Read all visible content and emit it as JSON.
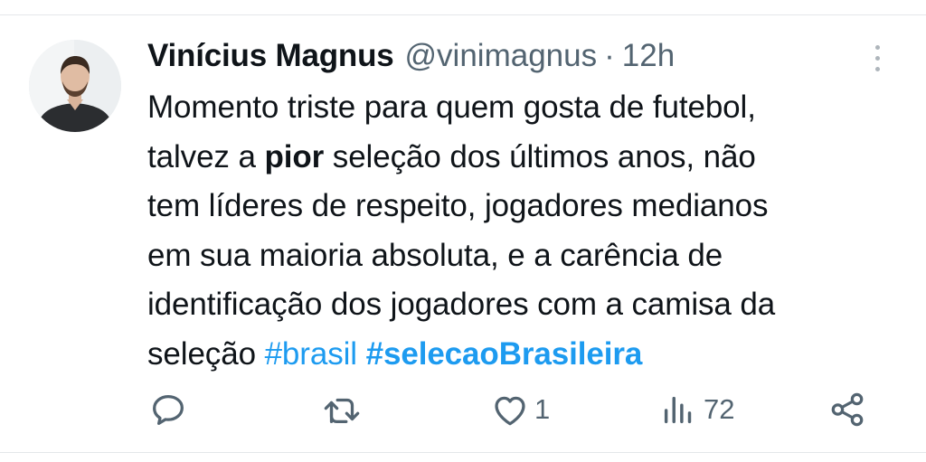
{
  "tweet": {
    "author_name": "Vinícius Magnus",
    "handle": "@vinimagnus",
    "separator": "·",
    "time": "12h",
    "text": {
      "line1": "Momento triste para quem gosta de futebol,",
      "line2_pre": "talvez a ",
      "line2_bold": "pior",
      "line2_post": " seleção dos últimos anos, não",
      "line3": "tem líderes de respeito, jogadores medianos",
      "line4": "em sua maioria absoluta, e a carência de",
      "line5": "identificação dos jogadores com a camisa da",
      "line6_pre": "seleção ",
      "hashtag1": "#brasil",
      "hashtag2": "#selecaoBrasileira"
    }
  },
  "actions": {
    "reply_icon": "reply-icon",
    "retweet_icon": "retweet-icon",
    "like_icon": "heart-icon",
    "like_count": "1",
    "views_icon": "views-icon",
    "views_count": "72",
    "share_icon": "share-icon"
  },
  "colors": {
    "text": "#0f1419",
    "secondary": "#536471",
    "link": "#1d9bf0"
  }
}
